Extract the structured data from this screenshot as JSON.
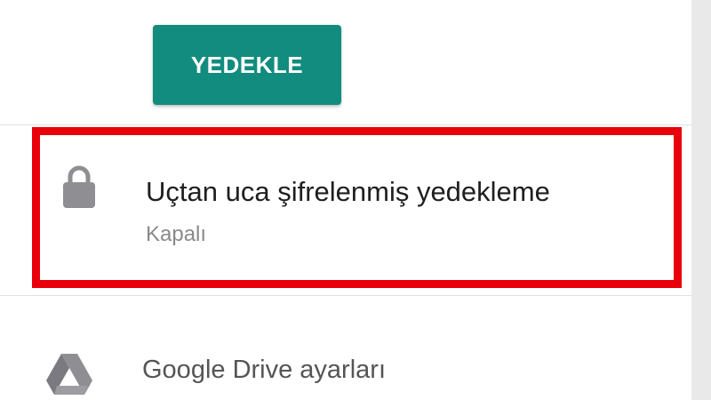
{
  "backup": {
    "button_label": "YEDEKLE"
  },
  "e2e_backup": {
    "title": "Uçtan uca şifrelenmiş yedekleme",
    "status": "Kapalı",
    "icon": "lock-icon",
    "highlight_color": "#e8000b"
  },
  "drive_settings": {
    "label": "Google Drive ayarları",
    "icon": "google-drive-icon"
  },
  "colors": {
    "accent": "#128c7e",
    "icon_gray": "#8e8e93"
  }
}
